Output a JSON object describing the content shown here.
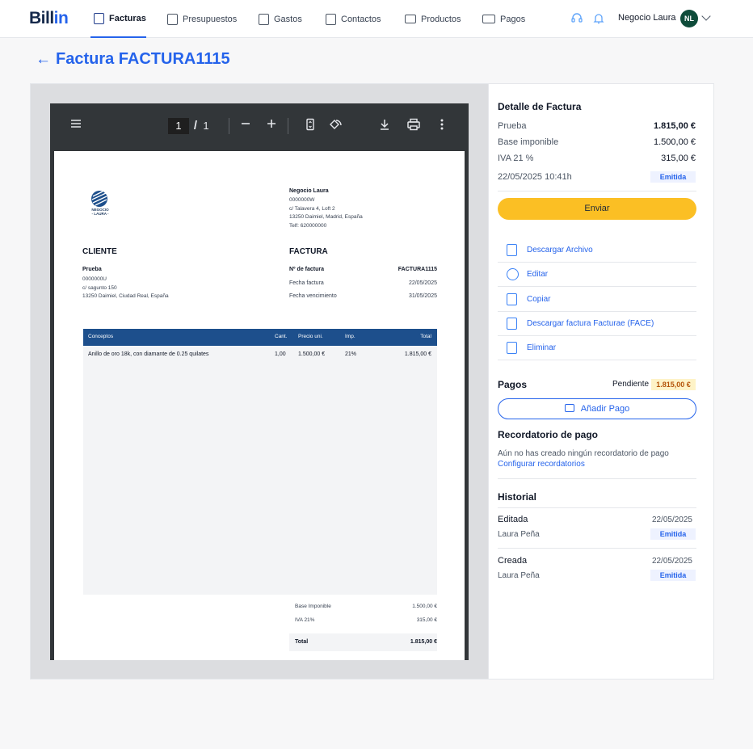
{
  "header": {
    "logo_main": "Bill",
    "logo_accent": "in",
    "nav": [
      {
        "label": "Facturas",
        "icon": "invoice-icon"
      },
      {
        "label": "Presupuestos",
        "icon": "quote-icon"
      },
      {
        "label": "Gastos",
        "icon": "expenses-icon"
      },
      {
        "label": "Contactos",
        "icon": "contacts-icon"
      },
      {
        "label": "Productos",
        "icon": "products-icon"
      },
      {
        "label": "Pagos",
        "icon": "payments-icon"
      }
    ],
    "user_name": "Negocio Laura",
    "avatar_initials": "NL"
  },
  "page": {
    "title": "Factura FACTURA1115"
  },
  "pdf_viewer": {
    "current_page": "1",
    "page_separator": "/",
    "total_pages": "1"
  },
  "invoice": {
    "logo_text": "NEGOCIO\n- LAURA -",
    "issuer": {
      "name": "Negocio Laura",
      "tax_id": "0000000W",
      "address": "c/ Talavera 4, Loft 2",
      "city": "13250 Daimiel, Madrid, España",
      "phone": "Telf: 620000000"
    },
    "client_heading": "CLIENTE",
    "client": {
      "name": "Prueba",
      "tax_id": "0000000U",
      "address": "c/ sagunto 150",
      "city": "13250 Daimiel, Ciudad Real, España"
    },
    "invoice_heading": "FACTURA",
    "number_label": "Nº de factura",
    "number_value": "FACTURA1115",
    "date_label": "Fecha factura",
    "date_value": "22/05/2025",
    "due_label": "Fecha vencimiento",
    "due_value": "31/05/2025",
    "table_headers": [
      "Conceptos",
      "Cant.",
      "Precio uni.",
      "Imp.",
      "Total"
    ],
    "rows": [
      {
        "concept": "Anillo de oro 18k, con diamante de 0.25 quilates",
        "qty": "1,00",
        "price": "1.500,00 €",
        "tax": "21%",
        "total": "1.815,00 €"
      }
    ],
    "base_label": "Base Imponible",
    "base_value": "1.500,00 €",
    "iva_label": "IVA 21%",
    "iva_value": "315,00 €",
    "total_label": "Total",
    "total_value": "1.815,00 €"
  },
  "panel": {
    "detail_title": "Detalle de Factura",
    "client_label": "Prueba",
    "client_total": "1.815,00 €",
    "base_label": "Base imponible",
    "base_value": "1.500,00 €",
    "iva_label": "IVA 21 %",
    "iva_value": "315,00 €",
    "datetime": "22/05/2025 10:41h",
    "status": "Emitida",
    "send_button": "Enviar",
    "actions": [
      {
        "label": "Descargar Archivo",
        "icon": "pdf-file-icon"
      },
      {
        "label": "Editar",
        "icon": "edit-icon"
      },
      {
        "label": "Copiar",
        "icon": "copy-icon"
      },
      {
        "label": "Descargar factura Facturae (FACE)",
        "icon": "facturae-file-icon"
      },
      {
        "label": "Eliminar",
        "icon": "trash-icon"
      }
    ],
    "payments_title": "Pagos",
    "payments_status": "Pendiente",
    "payments_amount": "1.815,00 €",
    "add_payment_button": "Añadir Pago",
    "reminder_title": "Recordatorio de pago",
    "reminder_text": "Aún no has creado ningún recordatorio de pago",
    "reminder_link": "Configurar recordatorios",
    "history_title": "Historial",
    "history": [
      {
        "action": "Editada",
        "date": "22/05/2025",
        "user": "Laura Peña",
        "status": "Emitida"
      },
      {
        "action": "Creada",
        "date": "22/05/2025",
        "user": "Laura Peña",
        "status": "Emitida"
      }
    ]
  },
  "colors": {
    "accent": "#2563eb",
    "send_button": "#fbbf24",
    "table_header": "#1d4f8c",
    "pdf_toolbar": "#323639"
  }
}
